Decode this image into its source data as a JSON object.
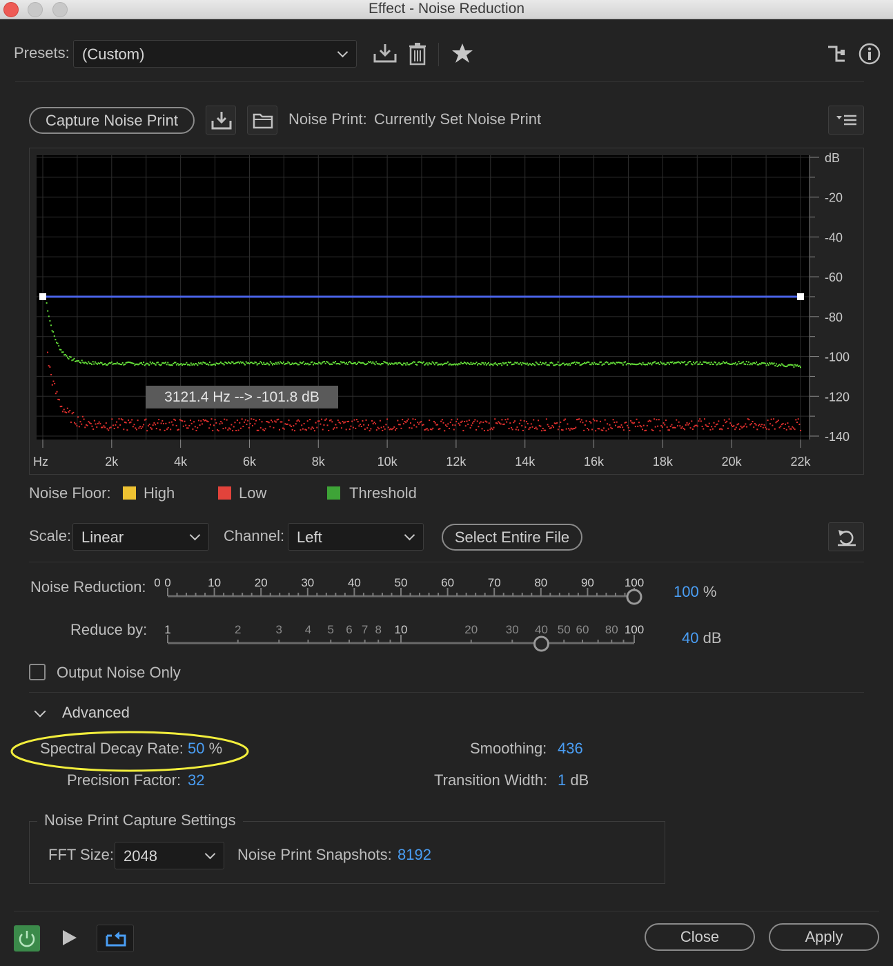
{
  "window": {
    "title": "Effect - Noise Reduction"
  },
  "presets": {
    "label": "Presets:",
    "value": "(Custom)"
  },
  "noise_print": {
    "capture_label": "Capture Noise Print",
    "label": "Noise Print:",
    "value": "Currently Set Noise Print"
  },
  "graph": {
    "tooltip": "3121.4 Hz --> -101.8 dB",
    "x_ticks": [
      "Hz",
      "2k",
      "4k",
      "6k",
      "8k",
      "10k",
      "12k",
      "14k",
      "16k",
      "18k",
      "20k",
      "22k"
    ],
    "y_ticks": [
      "dB",
      "-20",
      "-40",
      "-60",
      "-80",
      "-100",
      "-120",
      "-140"
    ],
    "colors": {
      "threshold_line": "#4a63e8",
      "green_trace": "#66e23a",
      "red_trace": "#e2302e",
      "bg": "#000000",
      "grid": "#2e2e2e"
    }
  },
  "legend": {
    "label": "Noise Floor:",
    "items": [
      {
        "label": "High",
        "color": "#eec232"
      },
      {
        "label": "Low",
        "color": "#e2433b"
      },
      {
        "label": "Threshold",
        "color": "#3ea437"
      }
    ]
  },
  "scale": {
    "label": "Scale:",
    "value": "Linear"
  },
  "channel": {
    "label": "Channel:",
    "value": "Left"
  },
  "select_entire_file": "Select Entire File",
  "noise_reduction": {
    "label": "Noise Reduction:",
    "value": "100",
    "unit": "%",
    "level": 1.0,
    "tick_labels": [
      "0",
      "0",
      "10",
      "20",
      "30",
      "40",
      "50",
      "60",
      "70",
      "80",
      "90",
      "100"
    ]
  },
  "reduce_by": {
    "label": "Reduce by:",
    "value": "40",
    "unit": "dB",
    "level_db": 40,
    "tick_labels": [
      "1",
      "2",
      "3",
      "4",
      "5",
      "6",
      "7",
      "8",
      "10",
      "20",
      "30",
      "40",
      "50",
      "60",
      "80",
      "100"
    ]
  },
  "output_noise_only": {
    "label": "Output Noise Only",
    "checked": false
  },
  "advanced": {
    "label": "Advanced",
    "spectral_decay_label": "Spectral Decay Rate:",
    "spectral_decay_value": "50",
    "spectral_decay_unit": "%",
    "precision_label": "Precision Factor:",
    "precision_value": "32",
    "smoothing_label": "Smoothing:",
    "smoothing_value": "436",
    "transition_label": "Transition Width:",
    "transition_value": "1",
    "transition_unit": "dB"
  },
  "capture_settings": {
    "legend": "Noise Print Capture Settings",
    "fft_label": "FFT Size:",
    "fft_value": "2048",
    "snapshots_label": "Noise Print Snapshots:",
    "snapshots_value": "8192"
  },
  "footer": {
    "close_label": "Close",
    "apply_label": "Apply"
  },
  "highlight_color": "#f2ee3c"
}
